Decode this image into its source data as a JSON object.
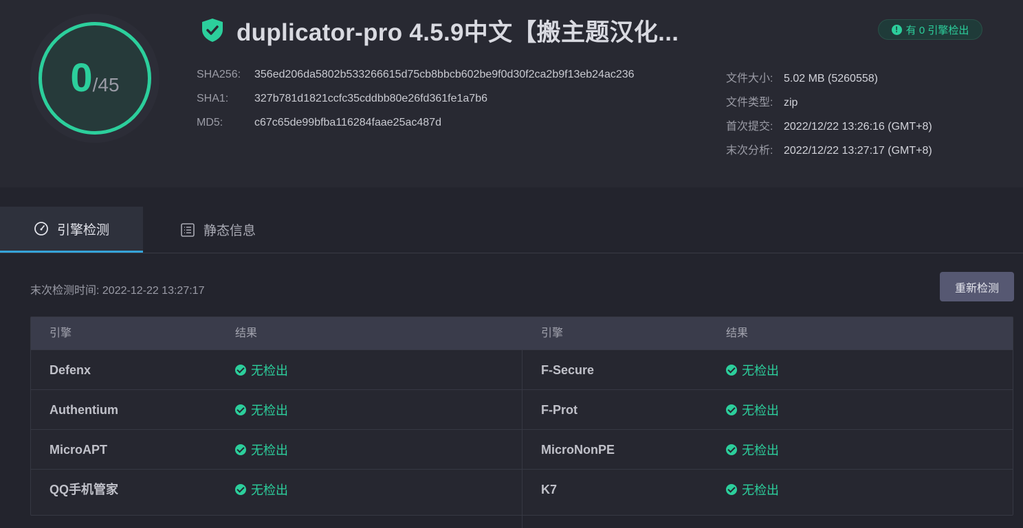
{
  "score": {
    "detected": "0",
    "total": "/45",
    "color": "#2ccf9c"
  },
  "file": {
    "title": "duplicator-pro 4.5.9中文【搬主题汉化..."
  },
  "badge": {
    "icon": "!",
    "label": "有 0 引擎检出"
  },
  "hashes": [
    {
      "label": "SHA256:",
      "value": "356ed206da5802b533266615d75cb8bbcb602be9f0d30f2ca2b9f13eb24ac236"
    },
    {
      "label": "SHA1:",
      "value": "327b781d1821ccfc35cddbb80e26fd361fe1a7b6"
    },
    {
      "label": "MD5:",
      "value": "c67c65de99bfba116284faae25ac487d"
    }
  ],
  "info": [
    {
      "label": "文件大小:",
      "value": "5.02 MB (5260558)"
    },
    {
      "label": "文件类型:",
      "value": "zip"
    },
    {
      "label": "首次提交:",
      "value": "2022/12/22 13:26:16 (GMT+8)"
    },
    {
      "label": "末次分析:",
      "value": "2022/12/22 13:27:17 (GMT+8)"
    }
  ],
  "tabs": [
    {
      "label": "引擎检测",
      "icon": "gauge-icon",
      "active": true
    },
    {
      "label": "静态信息",
      "icon": "list-icon",
      "active": false
    }
  ],
  "scan": {
    "last_scan": "末次检测时间: 2022-12-22 13:27:17",
    "rescan_label": "重新检测"
  },
  "table": {
    "headers": [
      "引擎",
      "结果",
      "引擎",
      "结果"
    ],
    "rows": [
      {
        "left_engine": "Defenx",
        "left_result": "无检出",
        "right_engine": "F-Secure",
        "right_result": "无检出"
      },
      {
        "left_engine": "Authentium",
        "left_result": "无检出",
        "right_engine": "F-Prot",
        "right_result": "无检出"
      },
      {
        "left_engine": "MicroAPT",
        "left_result": "无检出",
        "right_engine": "MicroNonPE",
        "right_result": "无检出"
      },
      {
        "left_engine": "QQ手机管家",
        "left_result": "无检出",
        "right_engine": "K7",
        "right_result": "无检出"
      }
    ]
  }
}
